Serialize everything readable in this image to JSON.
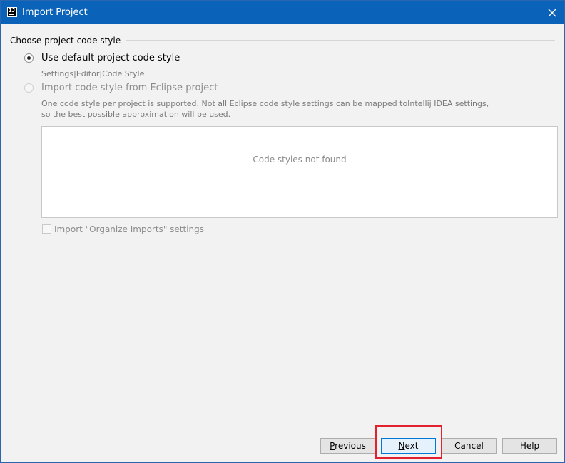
{
  "window": {
    "title": "Import Project",
    "app_icon_letters": "IJ"
  },
  "code_style": {
    "group_label": "Choose project code style",
    "option_default": {
      "label": "Use default project code style",
      "selected": true,
      "path_hint": "Settings|Editor|Code Style"
    },
    "option_eclipse": {
      "label": "Import code style from Eclipse project",
      "selected": false,
      "enabled": false,
      "hint_line1": "One code style per project is supported. Not all Eclipse code style settings can be mapped toIntellij IDEA settings,",
      "hint_line2": "so the best possible approximation will be used."
    },
    "styles_list": {
      "empty_text": "Code styles not found"
    },
    "organize_imports": {
      "label": "Import \"Organize Imports\" settings",
      "checked": false,
      "enabled": false
    }
  },
  "buttons": {
    "previous": {
      "mnemonic": "P",
      "rest": "revious"
    },
    "next": {
      "mnemonic": "N",
      "rest": "ext"
    },
    "cancel": "Cancel",
    "help": "Help"
  },
  "colors": {
    "titlebar": "#0a63b8",
    "highlight": "#e3202e",
    "primary_border": "#0078d7"
  }
}
